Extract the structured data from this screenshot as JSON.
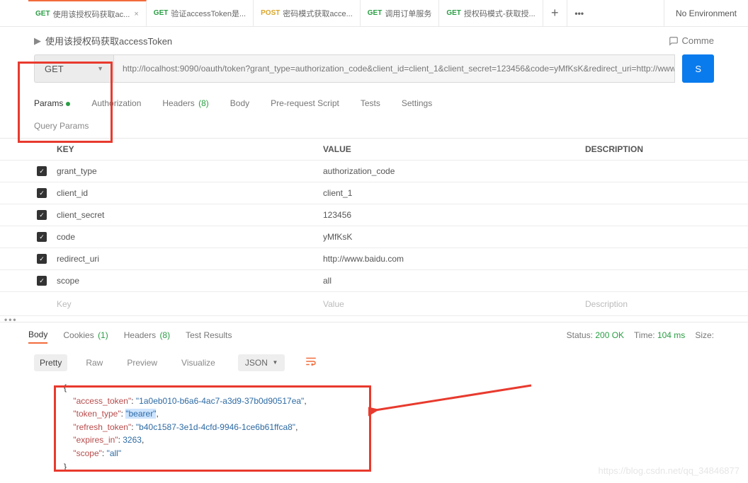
{
  "env": "No Environment",
  "tabs": [
    {
      "method": "GET",
      "mclass": "get",
      "title": "使用该授权码获取ac...",
      "active": true,
      "close": true
    },
    {
      "method": "GET",
      "mclass": "get",
      "title": "验证accessToken是..."
    },
    {
      "method": "POST",
      "mclass": "post",
      "title": "密码模式获取acce..."
    },
    {
      "method": "GET",
      "mclass": "get",
      "title": "调用订单服务"
    },
    {
      "method": "GET",
      "mclass": "get",
      "title": "授权码模式-获取授..."
    }
  ],
  "breadcrumb": "使用该授权码获取accessToken",
  "comments_label": "Comme",
  "method": "GET",
  "url": "http://localhost:9090/oauth/token?grant_type=authorization_code&client_id=client_1&client_secret=123456&code=yMfKsK&redirect_uri=http://www. ...",
  "send_label": "S",
  "request_tabs": {
    "params": "Params",
    "auth": "Authorization",
    "headers": "Headers",
    "headers_count": "(8)",
    "body": "Body",
    "prereq": "Pre-request Script",
    "tests": "Tests",
    "settings": "Settings"
  },
  "query_params_label": "Query Params",
  "param_headers": {
    "key": "KEY",
    "value": "VALUE",
    "desc": "DESCRIPTION"
  },
  "params": [
    {
      "key": "grant_type",
      "value": "authorization_code"
    },
    {
      "key": "client_id",
      "value": "client_1"
    },
    {
      "key": "client_secret",
      "value": "123456"
    },
    {
      "key": "code",
      "value": "yMfKsK"
    },
    {
      "key": "redirect_uri",
      "value": "http://www.baidu.com"
    },
    {
      "key": "scope",
      "value": "all"
    }
  ],
  "param_placeholder": {
    "key": "Key",
    "value": "Value",
    "desc": "Description"
  },
  "response_tabs": {
    "body": "Body",
    "cookies": "Cookies",
    "cookies_count": "(1)",
    "headers": "Headers",
    "headers_count": "(8)",
    "tests": "Test Results"
  },
  "status": {
    "label": "Status:",
    "value": "200 OK"
  },
  "time": {
    "label": "Time:",
    "value": "104 ms"
  },
  "size": {
    "label": "Size:"
  },
  "view_tabs": {
    "pretty": "Pretty",
    "raw": "Raw",
    "preview": "Preview",
    "visualize": "Visualize"
  },
  "format": "JSON",
  "json": {
    "access_token_k": "\"access_token\"",
    "access_token_v": "\"1a0eb010-b6a6-4ac7-a3d9-37b0d90517ea\"",
    "token_type_k": "\"token_type\"",
    "token_type_v": "\"bearer\"",
    "refresh_token_k": "\"refresh_token\"",
    "refresh_token_v": "\"b40c1587-3e1d-4cfd-9946-1ce6b61ffca8\"",
    "expires_in_k": "\"expires_in\"",
    "expires_in_v": "3263",
    "scope_k": "\"scope\"",
    "scope_v": "\"all\""
  },
  "watermark": "https://blog.csdn.net/qq_34846877"
}
